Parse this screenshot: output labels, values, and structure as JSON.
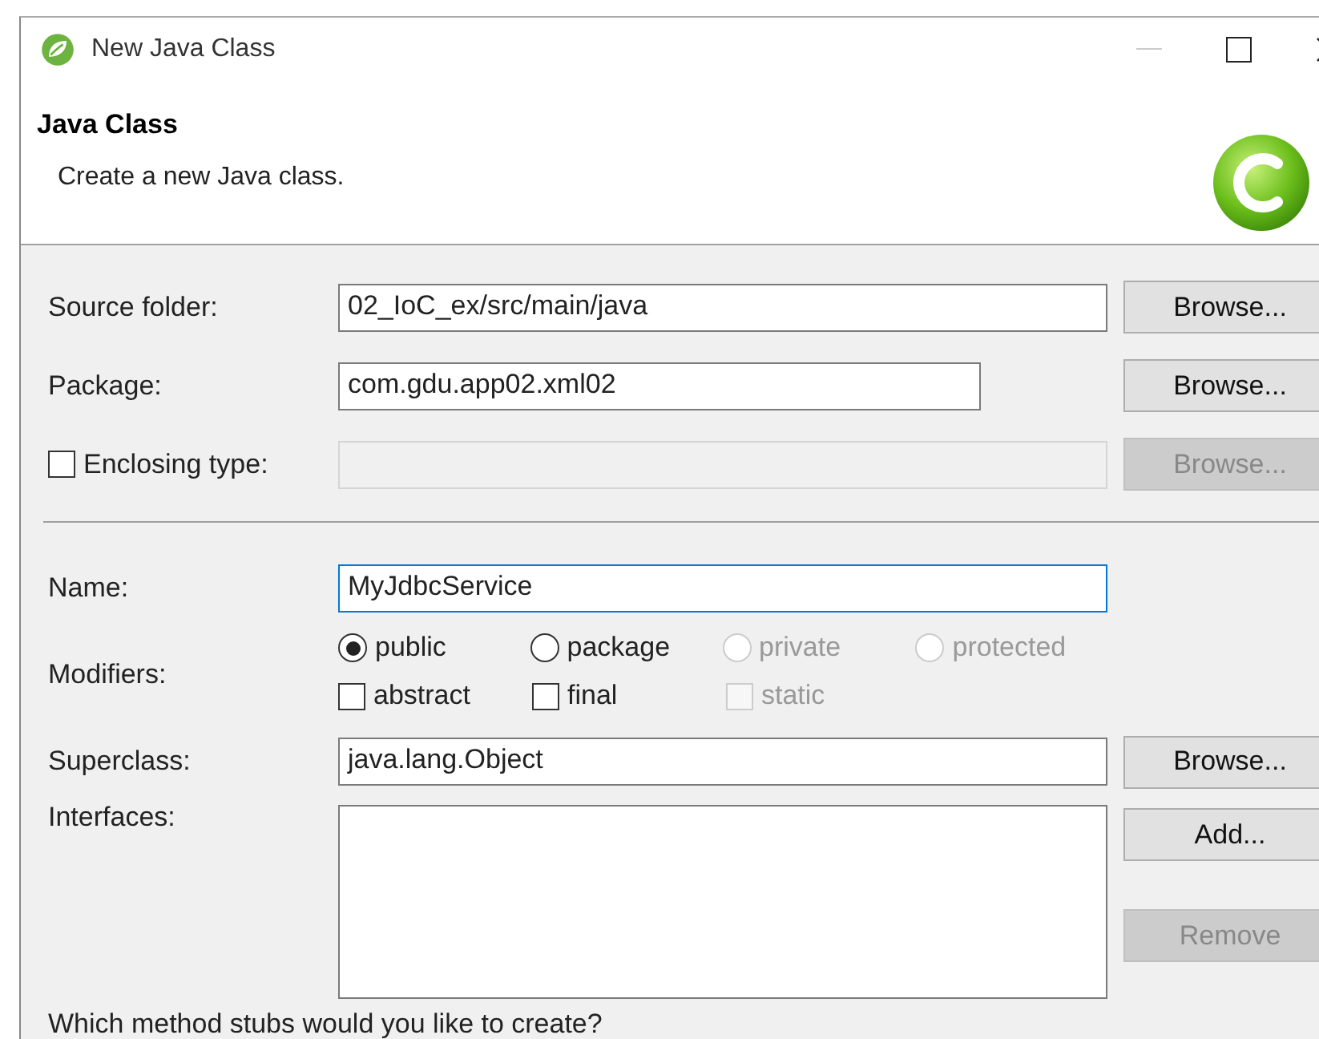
{
  "window": {
    "title": "New Java Class"
  },
  "header": {
    "title": "Java Class",
    "description": "Create a new Java class."
  },
  "rows": [
    {
      "kind": "text",
      "label": "Source folder:",
      "value": "02_IoC_ex/src/main/java",
      "disabled": false,
      "button": {
        "label": "Browse...",
        "disabled": false
      }
    },
    {
      "kind": "text",
      "label": "Package:",
      "value": "com.gdu.app02.xml02",
      "disabled": false,
      "button": {
        "label": "Browse...",
        "disabled": false
      }
    },
    {
      "kind": "checkbox",
      "label": "Enclosing type:",
      "checked": false,
      "disabled": true,
      "button": {
        "label": "Browse...",
        "disabled": true
      }
    }
  ],
  "name": {
    "label": "Name:",
    "value": "MyJdbcService",
    "focused": true
  },
  "modifiers": {
    "label": "Modifiers:",
    "access": [
      {
        "label": "public",
        "selected": true,
        "disabled": false
      },
      {
        "label": "package",
        "selected": false,
        "disabled": false
      },
      {
        "label": "private",
        "selected": false,
        "disabled": true
      },
      {
        "label": "protected",
        "selected": false,
        "disabled": true
      }
    ],
    "flags": [
      {
        "label": "abstract",
        "checked": false,
        "disabled": false
      },
      {
        "label": "final",
        "checked": false,
        "disabled": false
      },
      {
        "label": "static",
        "checked": false,
        "disabled": true
      }
    ]
  },
  "superclass": {
    "label": "Superclass:",
    "value": "java.lang.Object",
    "button": {
      "label": "Browse...",
      "disabled": false
    }
  },
  "interfaces": {
    "label": "Interfaces:",
    "buttons": [
      {
        "label": "Add...",
        "disabled": false
      },
      {
        "label": "Remove",
        "disabled": true
      }
    ]
  },
  "question": "Which method stubs would you like to create?"
}
